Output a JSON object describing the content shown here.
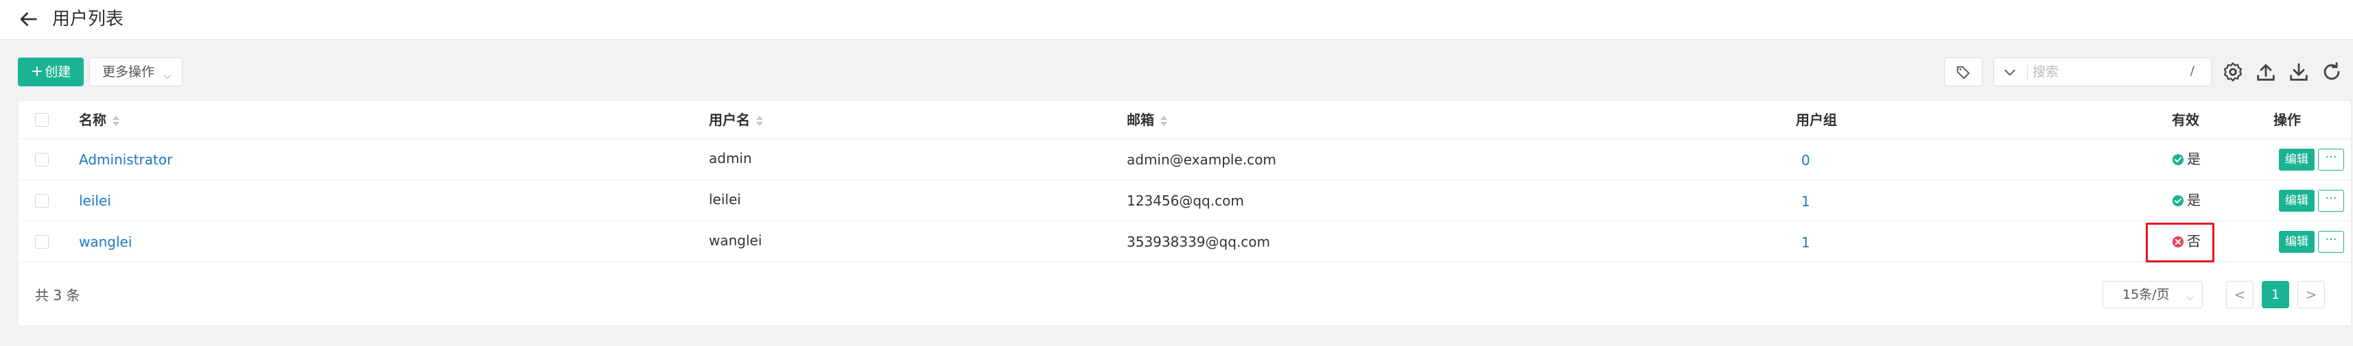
{
  "header": {
    "title": "用户列表"
  },
  "toolbar": {
    "create_label": "创建",
    "create_plus": "+",
    "more_label": "更多操作",
    "search_placeholder": "搜索",
    "search_value": "",
    "search_shortcut": "/"
  },
  "table": {
    "columns": {
      "name": "名称",
      "username": "用户名",
      "email": "邮箱",
      "group": "用户组",
      "active": "有效",
      "actions": "操作"
    },
    "rows": [
      {
        "name": "Administrator",
        "username": "admin",
        "email": "admin@example.com",
        "group": "0",
        "active": "是",
        "active_state": true,
        "edit": "编辑",
        "more": "···"
      },
      {
        "name": "leilei",
        "username": "leilei",
        "email": "123456@qq.com",
        "group": "1",
        "active": "是",
        "active_state": true,
        "edit": "编辑",
        "more": "···"
      },
      {
        "name": "wanglei",
        "username": "wanglei",
        "email": "353938339@qq.com",
        "group": "1",
        "active": "否",
        "active_state": false,
        "edit": "编辑",
        "more": "···"
      }
    ]
  },
  "footer": {
    "total": "共 3 条",
    "page_size": "15条/页",
    "current_page": "1",
    "prev": "<",
    "next": ">"
  },
  "colors": {
    "accent": "#1ab394",
    "link": "#1b78c3",
    "active": "#1ab394",
    "inactive": "#e04b59",
    "highlight": "#e4161e"
  },
  "icons": [
    "back-arrow-icon",
    "tag-icon",
    "chevron-down-icon",
    "gear-icon",
    "upload-icon",
    "download-icon",
    "refresh-icon",
    "check-circle-icon",
    "x-circle-icon"
  ]
}
